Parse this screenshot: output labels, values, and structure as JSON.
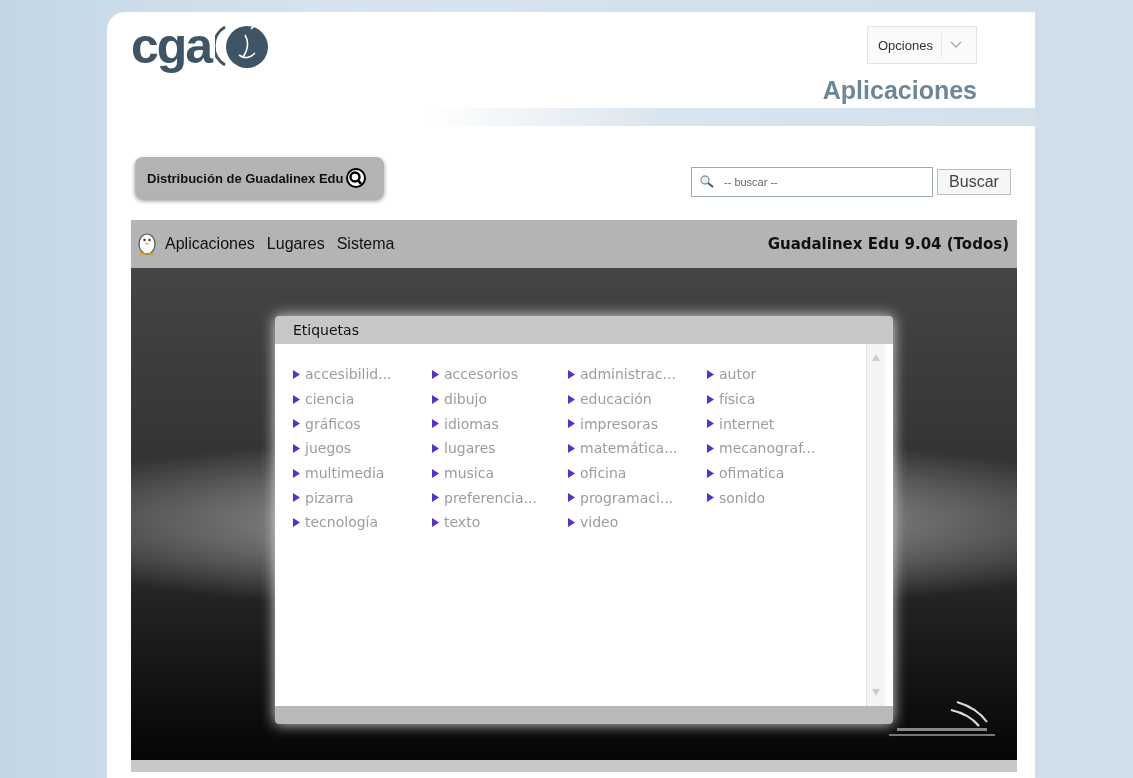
{
  "header": {
    "logo_text": "cga",
    "options_button": "Opciones",
    "page_title": "Aplicaciones"
  },
  "distribution_label": "Distribución de Guadalinex Edu",
  "search": {
    "placeholder": "-- buscar --",
    "button": "Buscar"
  },
  "panel": {
    "menus": [
      "Aplicaciones",
      "Lugares",
      "Sistema"
    ],
    "title": "Guadalinex Edu 9.04 (Todos)"
  },
  "dialog": {
    "title": "Etiquetas",
    "tags": [
      "accesibilid...",
      "accesorios",
      "administrac...",
      "autor",
      "ciencia",
      "dibujo",
      "educación",
      "física",
      "gráficos",
      "idiomas",
      "impresoras",
      "internet",
      "juegos",
      "lugares",
      "matemática...",
      "mecanograf...",
      "multimedia",
      "musica",
      "oficina",
      "ofimatica",
      "pizarra",
      "preferencia...",
      "programaci...",
      "sonido",
      "tecnología",
      "texto",
      "video"
    ]
  }
}
